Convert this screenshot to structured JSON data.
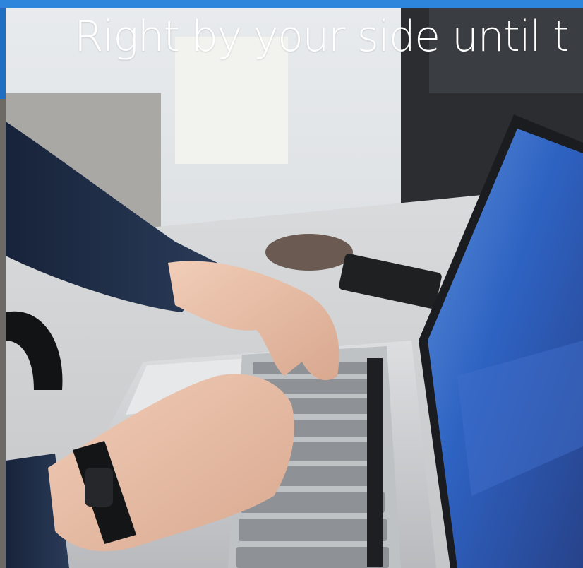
{
  "banner": {
    "headline": "Right by your side until t"
  },
  "photo": {
    "subject": "person typing on laptop",
    "colors": {
      "accent": "#2e86dc",
      "sleeve": "#1f2d44",
      "desk": "#d6d8da",
      "laptop": "#c8cbce",
      "screen": "#2f6fd6"
    }
  }
}
